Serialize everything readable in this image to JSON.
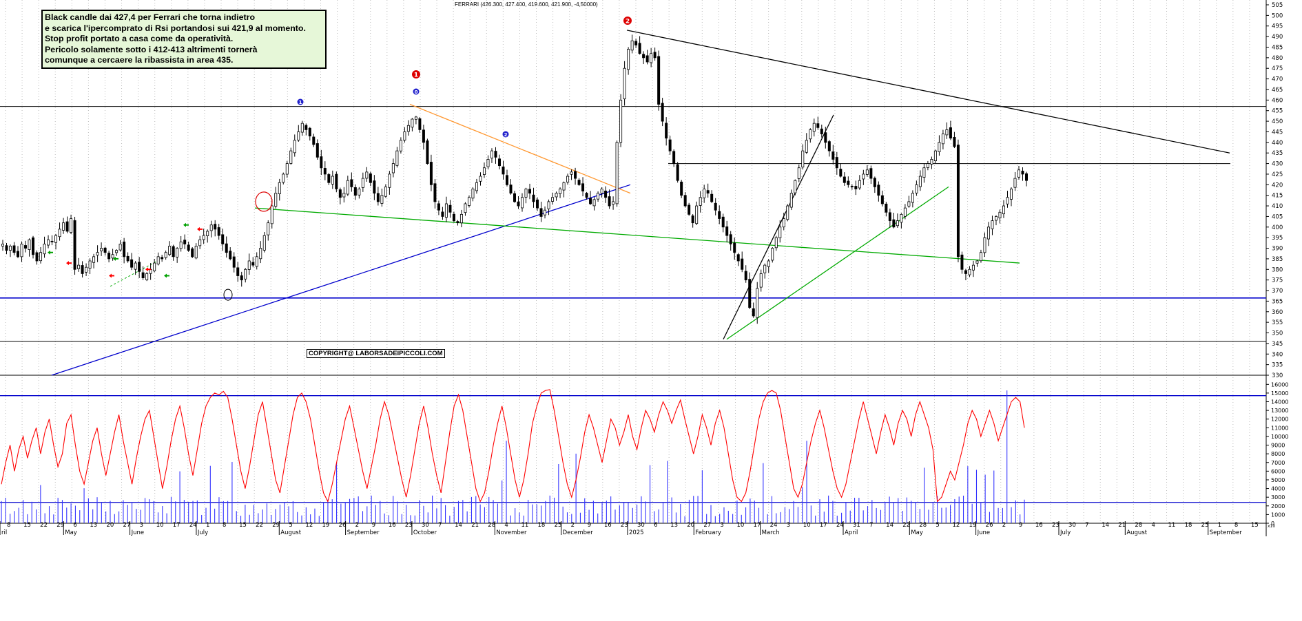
{
  "title": "FERRARI (426.300, 427.400, 419.600, 421.900, -4,50000)",
  "annotation_lines": [
    "Black candle dai 427,4 per Ferrari che torna indietro",
    "e scarica l'ipercomprato di Rsi portandosi sui 421,9 al momento.",
    "Stop profit portato a casa come da operatività.",
    "Pericolo solamente sotto i 412-413 altrimenti tornerà",
    "comunque a cercaere la ribassista in area 435."
  ],
  "copyright": "COPYRIGHT@ LABORSADEIPICCOLI.COM",
  "colors": {
    "candle": "#000000",
    "support_line": "#0000cc",
    "green_line": "#00aa00",
    "orange_line": "#ff9933",
    "rsi": "#ff0000",
    "volume": "#3333ff",
    "wave_blue": "#2222cc",
    "wave_red": "#dd0000"
  },
  "wave_labels": [
    {
      "label": "1",
      "color": "blue",
      "date_index": 29
    },
    {
      "label": "1",
      "color": "red",
      "date_index": 50
    },
    {
      "label": "0",
      "color": "blue",
      "date_index": 50
    },
    {
      "label": "2",
      "color": "blue",
      "date_index": 61
    },
    {
      "label": "2",
      "color": "red",
      "date_index": 76
    }
  ],
  "chart_data": {
    "type": "candlestick",
    "price_axis": {
      "ticks": [
        330,
        335,
        340,
        345,
        350,
        355,
        360,
        365,
        370,
        375,
        380,
        385,
        390,
        395,
        400,
        405,
        410,
        415,
        420,
        425,
        430,
        435,
        440,
        445,
        450,
        455,
        460,
        465,
        470,
        475,
        480,
        485,
        490,
        495,
        500,
        505
      ],
      "range": [
        330,
        505
      ]
    },
    "volume_axis": {
      "ticks": [
        0,
        1000,
        2000,
        3000,
        4000,
        5000,
        6000,
        7000,
        8000,
        9000,
        10000,
        11000,
        12000,
        13000,
        14000,
        15000,
        16000
      ],
      "range": [
        0,
        16500
      ],
      "unit_label": "x10"
    },
    "date_axis": {
      "days": [
        "8",
        "15",
        "22",
        "29",
        "6",
        "13",
        "20",
        "27",
        "3",
        "10",
        "17",
        "24",
        "1",
        "8",
        "15",
        "22",
        "29",
        "5",
        "12",
        "19",
        "26",
        "2",
        "9",
        "16",
        "23",
        "30",
        "7",
        "14",
        "21",
        "28",
        "4",
        "11",
        "18",
        "25",
        "2",
        "9",
        "16",
        "23",
        "30",
        "6",
        "13",
        "20",
        "27",
        "3",
        "10",
        "17",
        "24",
        "3",
        "10",
        "17",
        "24",
        "31",
        "7",
        "14",
        "22",
        "28",
        "5",
        "12",
        "19",
        "26",
        "2",
        "9",
        "16",
        "23",
        "30",
        "7",
        "14",
        "21",
        "28",
        "4",
        "11",
        "18",
        "25",
        "1",
        "8",
        "15"
      ],
      "months": [
        {
          "label": "ril",
          "at": 0
        },
        {
          "label": "May",
          "at": 4
        },
        {
          "label": "June",
          "at": 8
        },
        {
          "label": "July",
          "at": 12
        },
        {
          "label": "August",
          "at": 17
        },
        {
          "label": "September",
          "at": 21
        },
        {
          "label": "October",
          "at": 25
        },
        {
          "label": "November",
          "at": 30
        },
        {
          "label": "December",
          "at": 34
        },
        {
          "label": "2025",
          "at": 38
        },
        {
          "label": "February",
          "at": 42
        },
        {
          "label": "March",
          "at": 46
        },
        {
          "label": "April",
          "at": 51
        },
        {
          "label": "May",
          "at": 55
        },
        {
          "label": "June",
          "at": 59
        },
        {
          "label": "July",
          "at": 64
        },
        {
          "label": "August",
          "at": 68
        },
        {
          "label": "September",
          "at": 73
        }
      ]
    },
    "horizontal_levels": [
      457,
      366.5,
      346
    ],
    "close_series": [
      392,
      389,
      391,
      388,
      386,
      392,
      390,
      394,
      387,
      384,
      388,
      392,
      394,
      393,
      396,
      399,
      402,
      398,
      404,
      380,
      382,
      378,
      381,
      384,
      386,
      388,
      390,
      388,
      385,
      387,
      389,
      392,
      386,
      384,
      381,
      383,
      379,
      376,
      378,
      380,
      383,
      386,
      385,
      388,
      391,
      386,
      390,
      393,
      392,
      389,
      386,
      391,
      394,
      396,
      398,
      401,
      399,
      396,
      392,
      388,
      385,
      381,
      377,
      375,
      380,
      384,
      382,
      386,
      390,
      396,
      402,
      410,
      416,
      421,
      425,
      430,
      436,
      441,
      445,
      449,
      446,
      443,
      439,
      433,
      428,
      425,
      421,
      424,
      418,
      414,
      416,
      422,
      419,
      415,
      418,
      423,
      426,
      421,
      416,
      412,
      415,
      419,
      425,
      430,
      436,
      441,
      445,
      448,
      451,
      452,
      446,
      440,
      430,
      420,
      412,
      408,
      405,
      411,
      407,
      403,
      402,
      406,
      411,
      414,
      418,
      421,
      424,
      428,
      432,
      436,
      433,
      429,
      425,
      420,
      416,
      412,
      410,
      414,
      418,
      416,
      412,
      409,
      405,
      408,
      412,
      414,
      416,
      418,
      421,
      424,
      426,
      423,
      420,
      417,
      414,
      411,
      413,
      416,
      418,
      414,
      410,
      412,
      440,
      460,
      475,
      484,
      488,
      486,
      482,
      480,
      478,
      482,
      480,
      458,
      450,
      442,
      436,
      430,
      422,
      415,
      410,
      406,
      402,
      410,
      414,
      418,
      416,
      412,
      408,
      404,
      400,
      396,
      392,
      388,
      384,
      380,
      375,
      362,
      358,
      371,
      378,
      382,
      384,
      390,
      395,
      400,
      404,
      410,
      416,
      422,
      428,
      436,
      441,
      446,
      449,
      447,
      444,
      440,
      436,
      432,
      428,
      424,
      421,
      420,
      419,
      418,
      422,
      425,
      427,
      423,
      419,
      415,
      411,
      407,
      403,
      400,
      403,
      406,
      409,
      412,
      416,
      420,
      424,
      428,
      430,
      432,
      436,
      440,
      444,
      446,
      442,
      438,
      386,
      380,
      378,
      380,
      382,
      384,
      388,
      395,
      400,
      403,
      405,
      407,
      410,
      414,
      418,
      423,
      427,
      425,
      422
    ],
    "rsi_series": [
      4500,
      7000,
      9000,
      6000,
      8500,
      10000,
      7500,
      9500,
      11000,
      8000,
      10500,
      12000,
      9000,
      6500,
      8000,
      11500,
      12500,
      9000,
      6000,
      4500,
      7000,
      9500,
      11000,
      8000,
      5500,
      8000,
      10500,
      12500,
      9500,
      7000,
      4500,
      7500,
      10000,
      12000,
      13000,
      10000,
      7000,
      4000,
      6500,
      9500,
      12000,
      13500,
      11000,
      8000,
      5500,
      8500,
      11500,
      13500,
      14500,
      15000,
      14800,
      15200,
      14500,
      12000,
      9000,
      6000,
      4000,
      6500,
      9500,
      12500,
      14000,
      11000,
      8000,
      5000,
      3500,
      6500,
      9500,
      12500,
      14500,
      15000,
      14000,
      12000,
      9000,
      6000,
      3500,
      2500,
      4500,
      7000,
      9500,
      12000,
      13500,
      11000,
      8500,
      6000,
      4000,
      6500,
      9000,
      12000,
      14000,
      12500,
      10000,
      7500,
      5000,
      3000,
      5500,
      8500,
      11500,
      13500,
      11000,
      8000,
      5500,
      3500,
      7000,
      10500,
      13500,
      14800,
      13000,
      10000,
      7000,
      4000,
      2500,
      3500,
      6000,
      9000,
      11500,
      13500,
      11000,
      8000,
      5000,
      3000,
      5000,
      8000,
      11500,
      13500,
      15000,
      15300,
      15400,
      13000,
      10000,
      7000,
      4500,
      3000,
      5000,
      7500,
      10500,
      12500,
      11000,
      9000,
      7000,
      9500,
      12000,
      11000,
      9000,
      10500,
      12500,
      10000,
      8500,
      11000,
      13000,
      12000,
      10500,
      12500,
      14000,
      13000,
      11500,
      13000,
      14200,
      12000,
      10000,
      8000,
      10000,
      12500,
      11000,
      9000,
      11500,
      13000,
      11000,
      8000,
      5000,
      3000,
      2500,
      3500,
      6000,
      9000,
      12000,
      14000,
      15000,
      15300,
      15000,
      13000,
      10000,
      7000,
      4000,
      3000,
      4500,
      7000,
      9500,
      11500,
      13000,
      11000,
      8500,
      6000,
      4000,
      3000,
      4500,
      7000,
      9500,
      12000,
      14000,
      12000,
      10000,
      8000,
      10500,
      12500,
      11000,
      9000,
      11500,
      13000,
      12000,
      10000,
      12500,
      14000,
      12500,
      11000,
      8500,
      2500,
      3000,
      4500,
      6000,
      5000,
      7000,
      9000,
      11500,
      13000,
      12000,
      10000,
      11500,
      13000,
      11500,
      9500,
      11000,
      12500,
      14000,
      14500,
      14000,
      11000
    ],
    "volume_note": "Volume bars shown in blue; most around 1000-3000, with spikes up to ~15300."
  }
}
